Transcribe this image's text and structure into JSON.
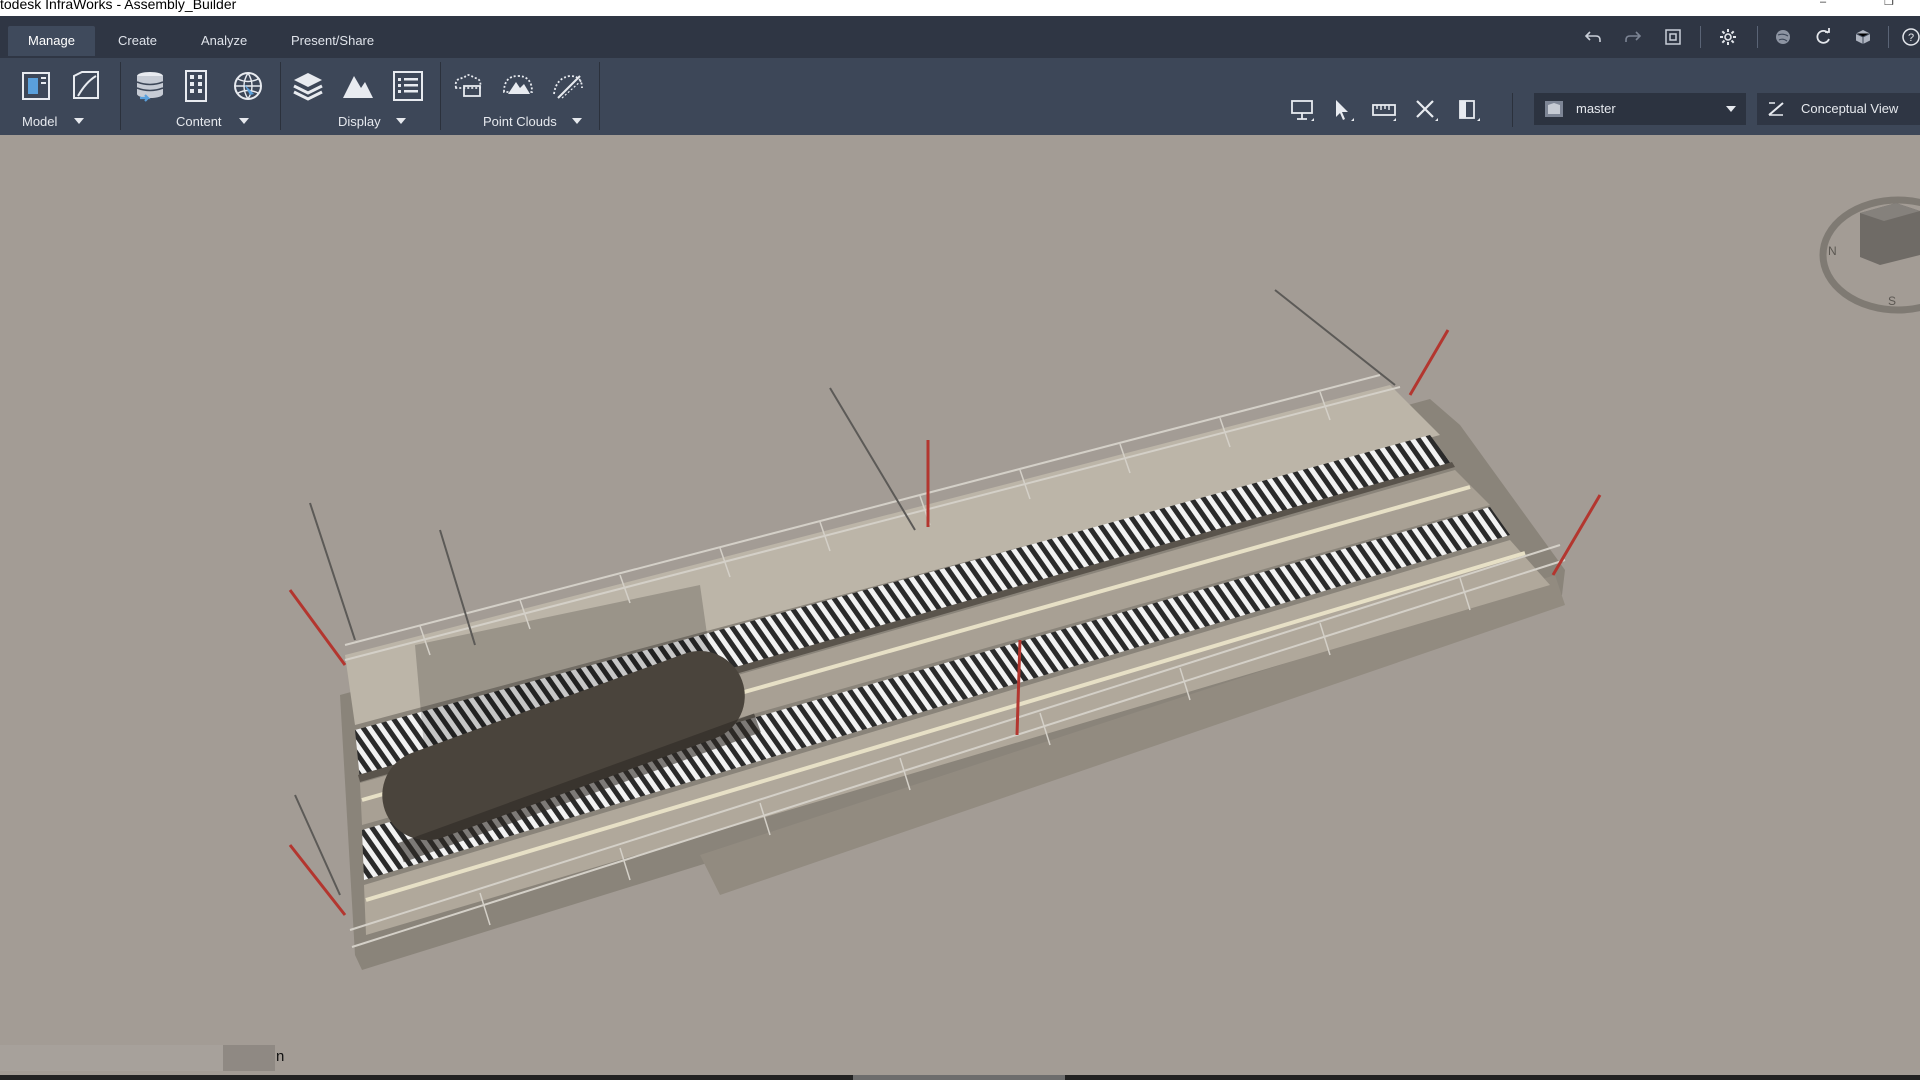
{
  "window": {
    "title": "todesk InfraWorks - Assembly_Builder"
  },
  "tabs": [
    {
      "label": "Manage",
      "active": true
    },
    {
      "label": "Create",
      "active": false
    },
    {
      "label": "Analyze",
      "active": false
    },
    {
      "label": "Present/Share",
      "active": false
    }
  ],
  "quick_access_icons": [
    "undo-icon",
    "redo-icon",
    "fit-view-icon",
    "settings-icon",
    "globe-icon",
    "refresh-icon",
    "cube-icon",
    "help-icon"
  ],
  "ribbon": {
    "groups": [
      {
        "label": "Model",
        "icons": [
          "model-explorer-icon",
          "model-properties-icon"
        ]
      },
      {
        "label": "Content",
        "icons": [
          "data-sources-icon",
          "building-icon",
          "globe-layer-icon"
        ]
      },
      {
        "label": "Display",
        "icons": [
          "layers-icon",
          "terrain-icon",
          "list-icon"
        ]
      },
      {
        "label": "Point Clouds",
        "icons": [
          "point-cloud-icon",
          "point-cloud-terrain-icon",
          "point-cloud-edit-icon"
        ]
      }
    ]
  },
  "view_tools": [
    "presentation-icon",
    "select-icon",
    "measure-icon",
    "close-tools-icon",
    "panel-icon"
  ],
  "proposal": {
    "value": "master"
  },
  "visual_style": {
    "label": "Conceptual View"
  },
  "status": {
    "progress": 0.81,
    "text": "n"
  },
  "navcube": {
    "compass_letters": [
      "N",
      "S"
    ]
  },
  "colors": {
    "tabbar": "#2f3644",
    "ribbon": "#3d4758",
    "viewport": "#a39c95",
    "accent_tab": "#3f4a5c"
  }
}
